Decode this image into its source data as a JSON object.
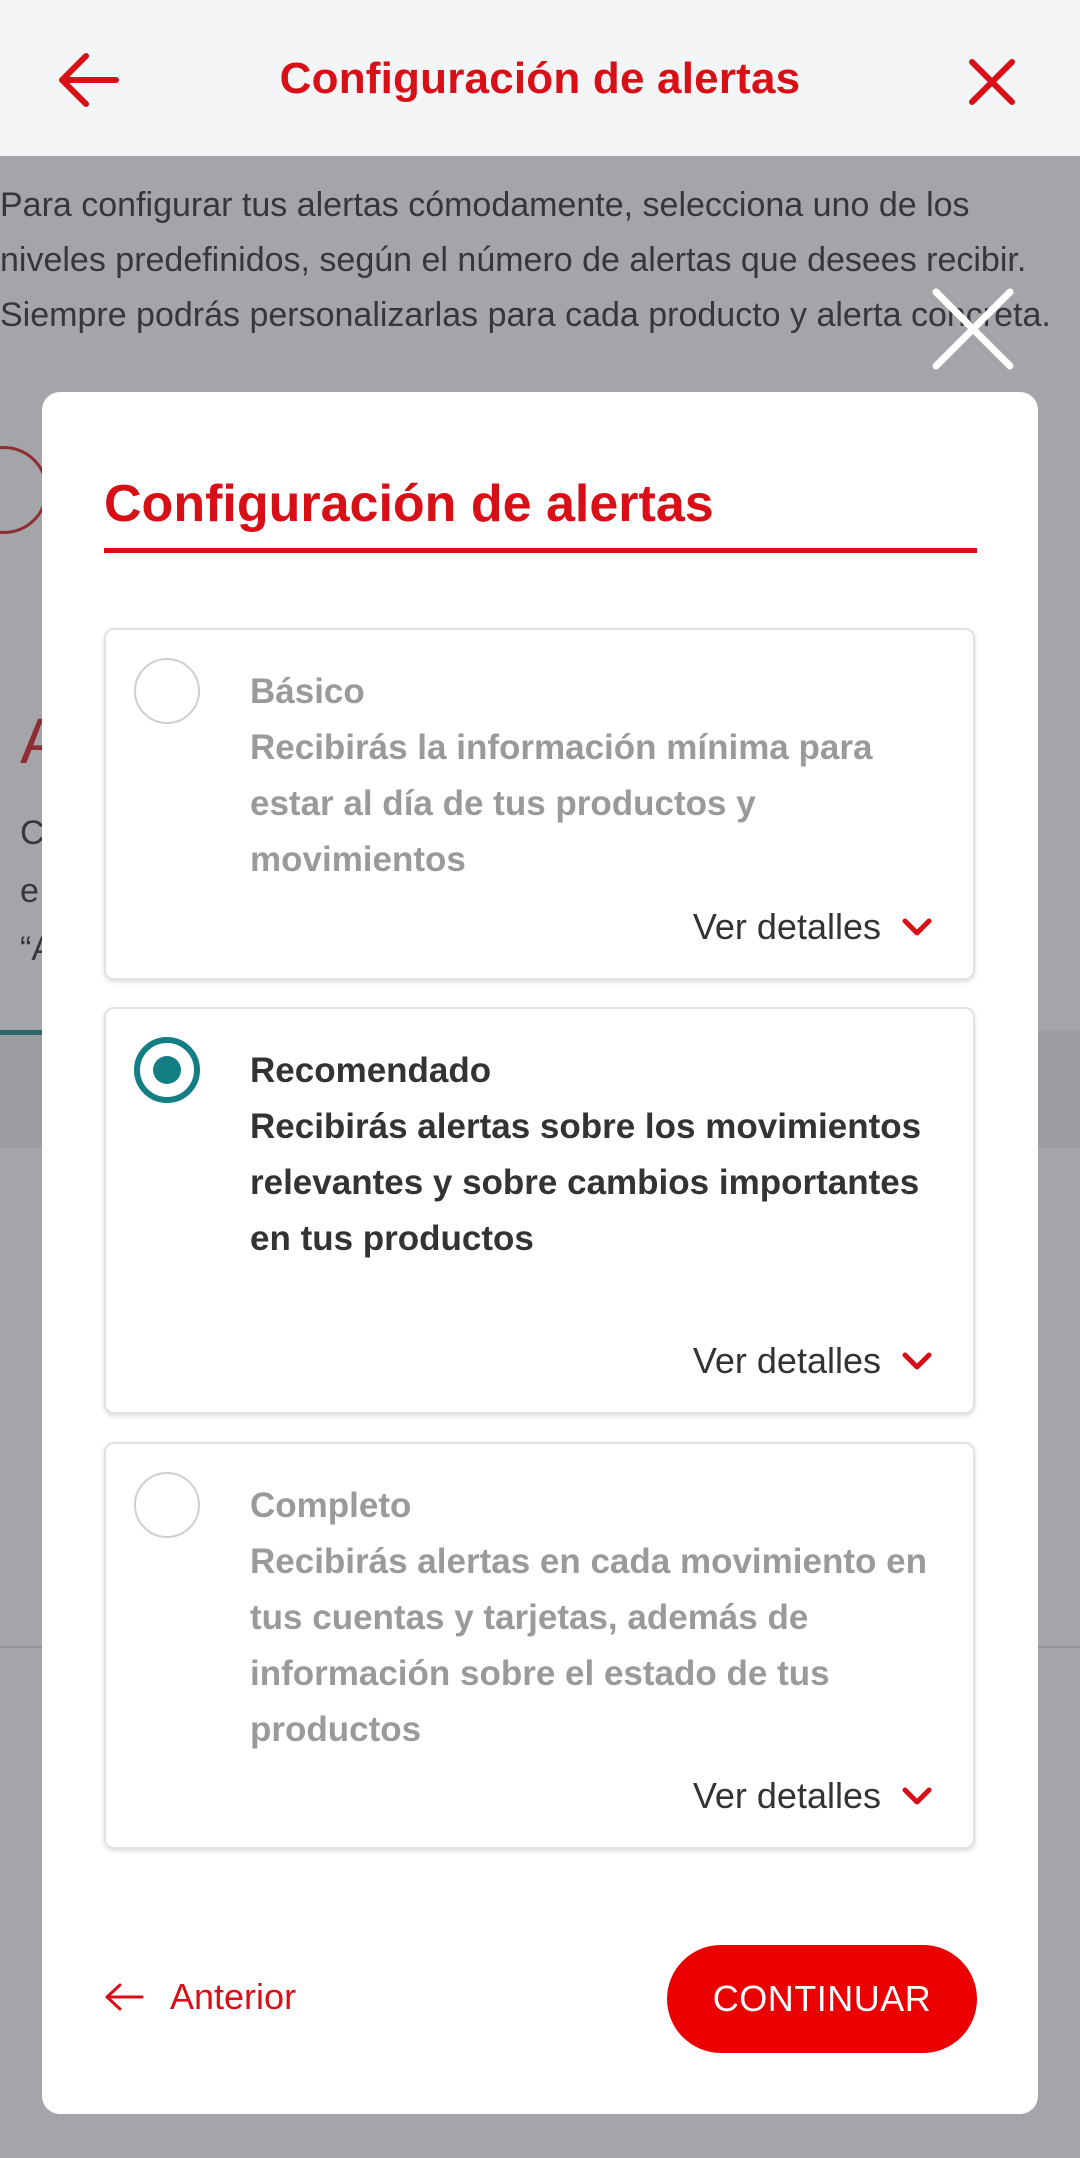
{
  "appbar": {
    "title": "Configuración de alertas",
    "back_icon": "arrow-left-icon",
    "close_icon": "close-icon"
  },
  "background": {
    "intro": "Para configurar tus alertas cómodamente, selecciona uno de los niveles predefinidos, según el número de alertas que desees recibir. Siempre podrás personalizarlas para cada producto y alerta concreta.",
    "partial_heading": "A",
    "partial_lines": [
      "C",
      "e",
      "“A"
    ]
  },
  "modal": {
    "title": "Configuración de alertas",
    "options": [
      {
        "name": "Básico",
        "description": "Recibirás la información mínima para estar al día de tus productos y movimientos",
        "details_label": "Ver detalles",
        "selected": false
      },
      {
        "name": "Recomendado",
        "description": "Recibirás alertas sobre los movimientos relevantes y sobre cambios importantes en tus productos",
        "details_label": "Ver detalles",
        "selected": true
      },
      {
        "name": "Completo",
        "description": "Recibirás alertas en cada movimiento en tus cuentas y tarjetas, además de información sobre el estado de tus productos",
        "details_label": "Ver detalles",
        "selected": false
      }
    ],
    "previous_label": "Anterior",
    "continue_label": "CONTINUAR"
  },
  "colors": {
    "brand_red": "#d80f16",
    "button_red": "#ea0000",
    "selected_teal": "#137e84"
  }
}
